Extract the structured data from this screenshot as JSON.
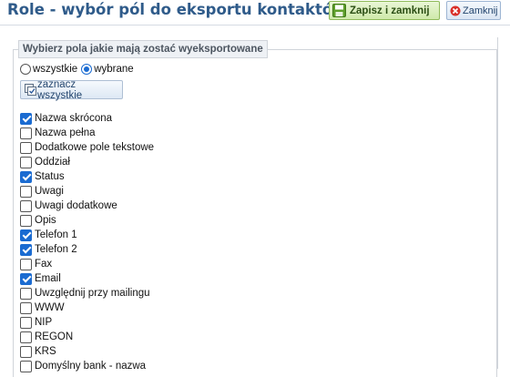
{
  "header": {
    "title": "Role - wybór pól do eksportu kontaktów",
    "save_close_label": "Zapisz i zamknij",
    "close_label": "Zamknij"
  },
  "panel": {
    "legend": "Wybierz pola jakie mają zostać wyeksportowane",
    "radio_all_label": "wszystkie",
    "radio_selected_label": "wybrane",
    "selected_mode": "wybrane",
    "select_all_label": "zaznacz wszystkie"
  },
  "fields": [
    {
      "label": "Nazwa skrócona",
      "checked": true
    },
    {
      "label": "Nazwa pełna",
      "checked": false
    },
    {
      "label": "Dodatkowe pole tekstowe",
      "checked": false
    },
    {
      "label": "Oddział",
      "checked": false
    },
    {
      "label": "Status",
      "checked": true
    },
    {
      "label": "Uwagi",
      "checked": false
    },
    {
      "label": "Uwagi dodatkowe",
      "checked": false
    },
    {
      "label": "Opis",
      "checked": false
    },
    {
      "label": "Telefon 1",
      "checked": true
    },
    {
      "label": "Telefon 2",
      "checked": true
    },
    {
      "label": "Fax",
      "checked": false
    },
    {
      "label": "Email",
      "checked": true
    },
    {
      "label": "Uwzględnij przy mailingu",
      "checked": false
    },
    {
      "label": "WWW",
      "checked": false
    },
    {
      "label": "NIP",
      "checked": false
    },
    {
      "label": "REGON",
      "checked": false
    },
    {
      "label": "KRS",
      "checked": false
    },
    {
      "label": "Domyślny bank - nazwa",
      "checked": false
    }
  ],
  "colors": {
    "title": "#2f5b8a",
    "accent_checkbox": "#1a6bd1",
    "save_button_bg": "#cfe9aa"
  },
  "icons": {
    "save": "save-icon",
    "close": "close-icon",
    "select_all": "select-all-icon"
  }
}
